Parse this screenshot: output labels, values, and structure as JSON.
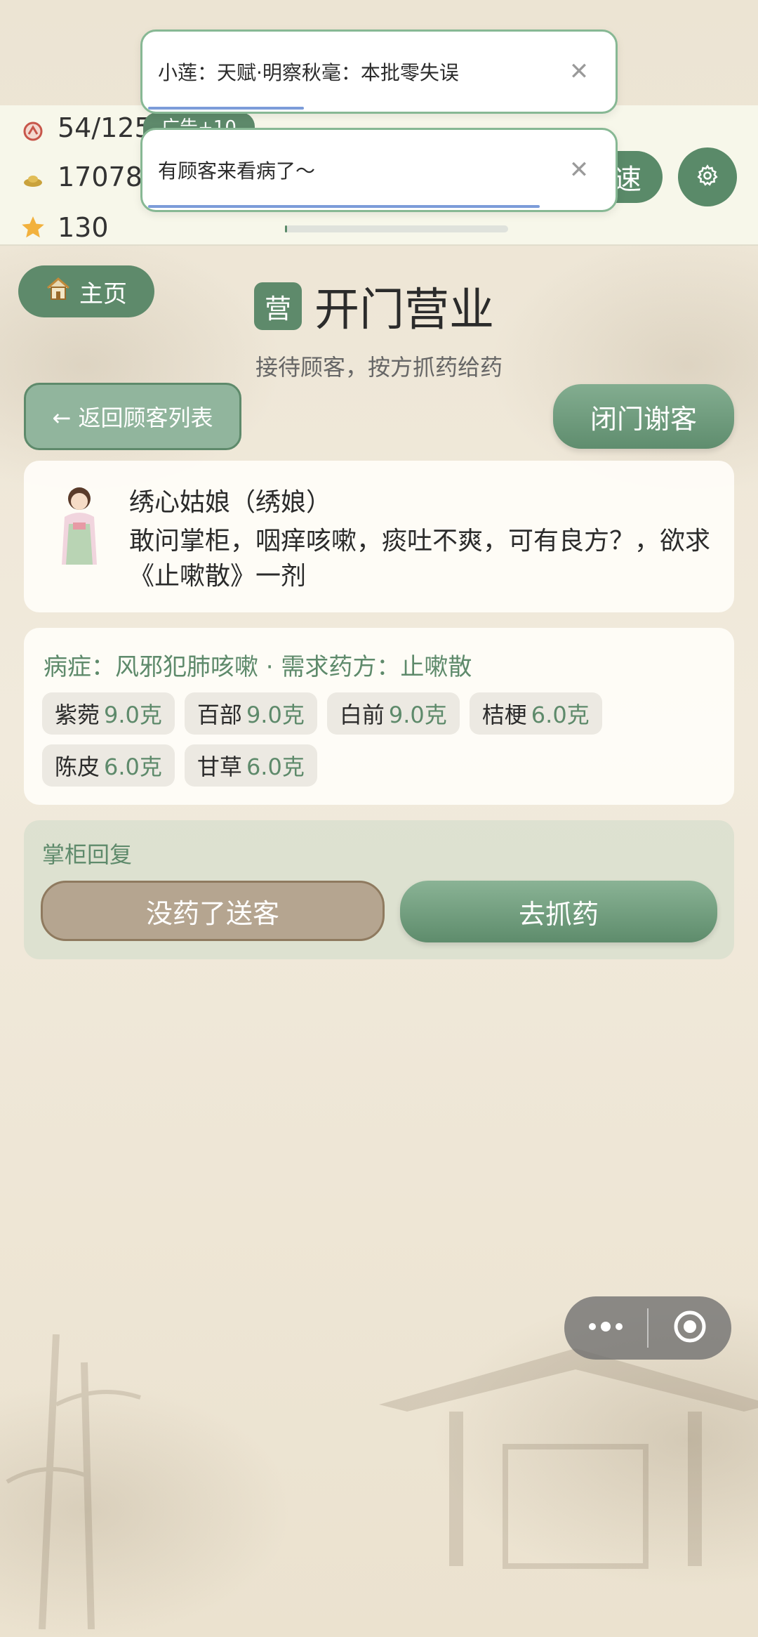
{
  "stats": {
    "energy": "54/125",
    "coins": "17078",
    "stars": "130",
    "ad_badge": "广告+10"
  },
  "toolbar": {
    "speed_label": "速"
  },
  "toasts": [
    {
      "text": "小莲：天赋·明察秋毫：本批零失误"
    },
    {
      "text": "有顾客来看病了～"
    }
  ],
  "header": {
    "home_label": "主页",
    "title_badge": "营",
    "title": "开门营业",
    "subtitle": "接待顾客，按方抓药给药",
    "back_label": "← 返回顾客列表",
    "close_shop_label": "闭门谢客"
  },
  "customer": {
    "name": "绣心姑娘（绣娘）",
    "message": "敢问掌柜，咽痒咳嗽，痰吐不爽，可有良方？，欲求《止嗽散》一剂"
  },
  "prescription": {
    "summary": "病症：风邪犯肺咳嗽 · 需求药方：止嗽散",
    "herbs": [
      {
        "name": "紫菀",
        "qty": "9.0克"
      },
      {
        "name": "百部",
        "qty": "9.0克"
      },
      {
        "name": "白前",
        "qty": "9.0克"
      },
      {
        "name": "桔梗",
        "qty": "6.0克"
      },
      {
        "name": "陈皮",
        "qty": "6.0克"
      },
      {
        "name": "甘草",
        "qty": "6.0克"
      }
    ]
  },
  "reply": {
    "label": "掌柜回复",
    "no_medicine_label": "没药了送客",
    "grab_label": "去抓药"
  },
  "colors": {
    "accent": "#5e8a6b",
    "toast_border": "#87b894",
    "secondary_button": "#b5a590"
  }
}
